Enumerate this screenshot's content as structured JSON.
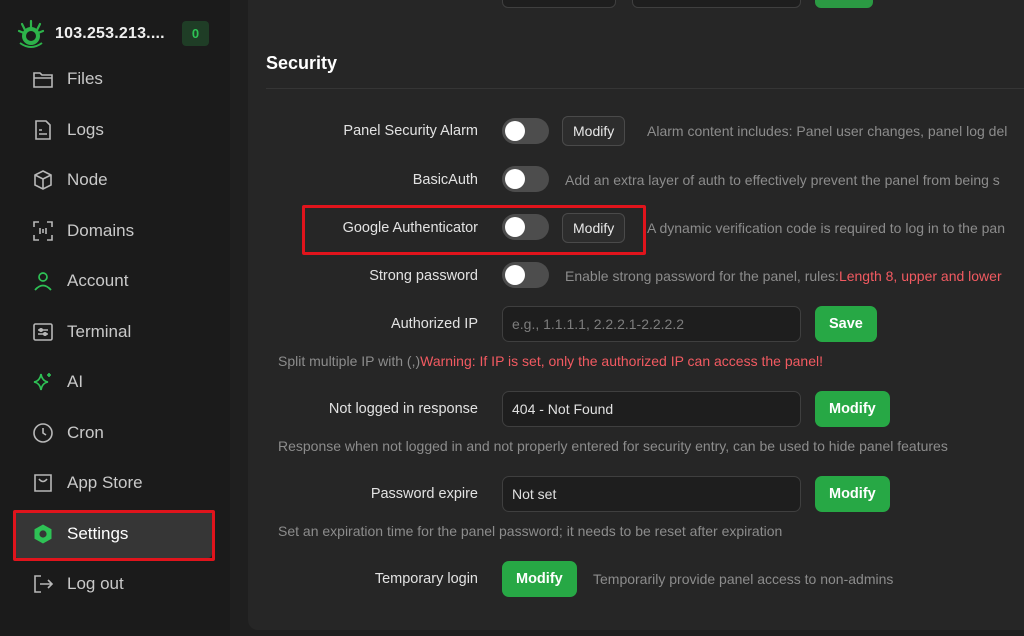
{
  "sidebar": {
    "host": "103.253.213....",
    "badge": "0",
    "items": [
      {
        "label": "Files",
        "icon": "folder-icon"
      },
      {
        "label": "Logs",
        "icon": "log-file-icon"
      },
      {
        "label": "Node",
        "icon": "cube-icon"
      },
      {
        "label": "Domains",
        "icon": "domain-icon"
      },
      {
        "label": "Account",
        "icon": "user-icon"
      },
      {
        "label": "Terminal",
        "icon": "terminal-icon"
      },
      {
        "label": "AI",
        "icon": "sparkle-icon"
      },
      {
        "label": "Cron",
        "icon": "clock-icon"
      },
      {
        "label": "App Store",
        "icon": "store-icon"
      },
      {
        "label": "Settings",
        "icon": "settings-hex-icon",
        "active": true
      },
      {
        "label": "Log out",
        "icon": "logout-icon"
      }
    ]
  },
  "security": {
    "title": "Security",
    "panel_alarm": {
      "label": "Panel Security Alarm",
      "button": "Modify",
      "desc": "Alarm content includes: Panel user changes, panel log del"
    },
    "basic_auth": {
      "label": "BasicAuth",
      "desc": "Add an extra layer of auth to effectively prevent the panel from being s"
    },
    "google_auth": {
      "label": "Google Authenticator",
      "button": "Modify",
      "desc": "A dynamic verification code is required to log in to the pan"
    },
    "strong_password": {
      "label": "Strong password",
      "desc": "Enable strong password for the panel, rules:",
      "desc_warn": "Length 8, upper and lower"
    },
    "authorized_ip": {
      "label": "Authorized IP",
      "placeholder": "e.g., 1.1.1.1, 2.2.2.1-2.2.2.2",
      "button": "Save",
      "hint": "Split multiple IP with (,)",
      "hint_warn": "Warning: If IP is set, only the authorized IP can access the panel!"
    },
    "not_logged": {
      "label": "Not logged in response",
      "value": "404 - Not Found",
      "button": "Modify",
      "hint": "Response when not logged in and not properly entered for security entry, can be used to hide panel features"
    },
    "password_expire": {
      "label": "Password expire",
      "value": "Not set",
      "button": "Modify",
      "hint": "Set an expiration time for the panel password; it needs to be reset after expiration"
    },
    "temp_login": {
      "label": "Temporary login",
      "button": "Modify",
      "desc": "Temporarily provide panel access to non-admins"
    }
  },
  "colors": {
    "accent_green": "#27a845",
    "warning_red": "#f25a61",
    "highlight_red": "#e0141c"
  }
}
